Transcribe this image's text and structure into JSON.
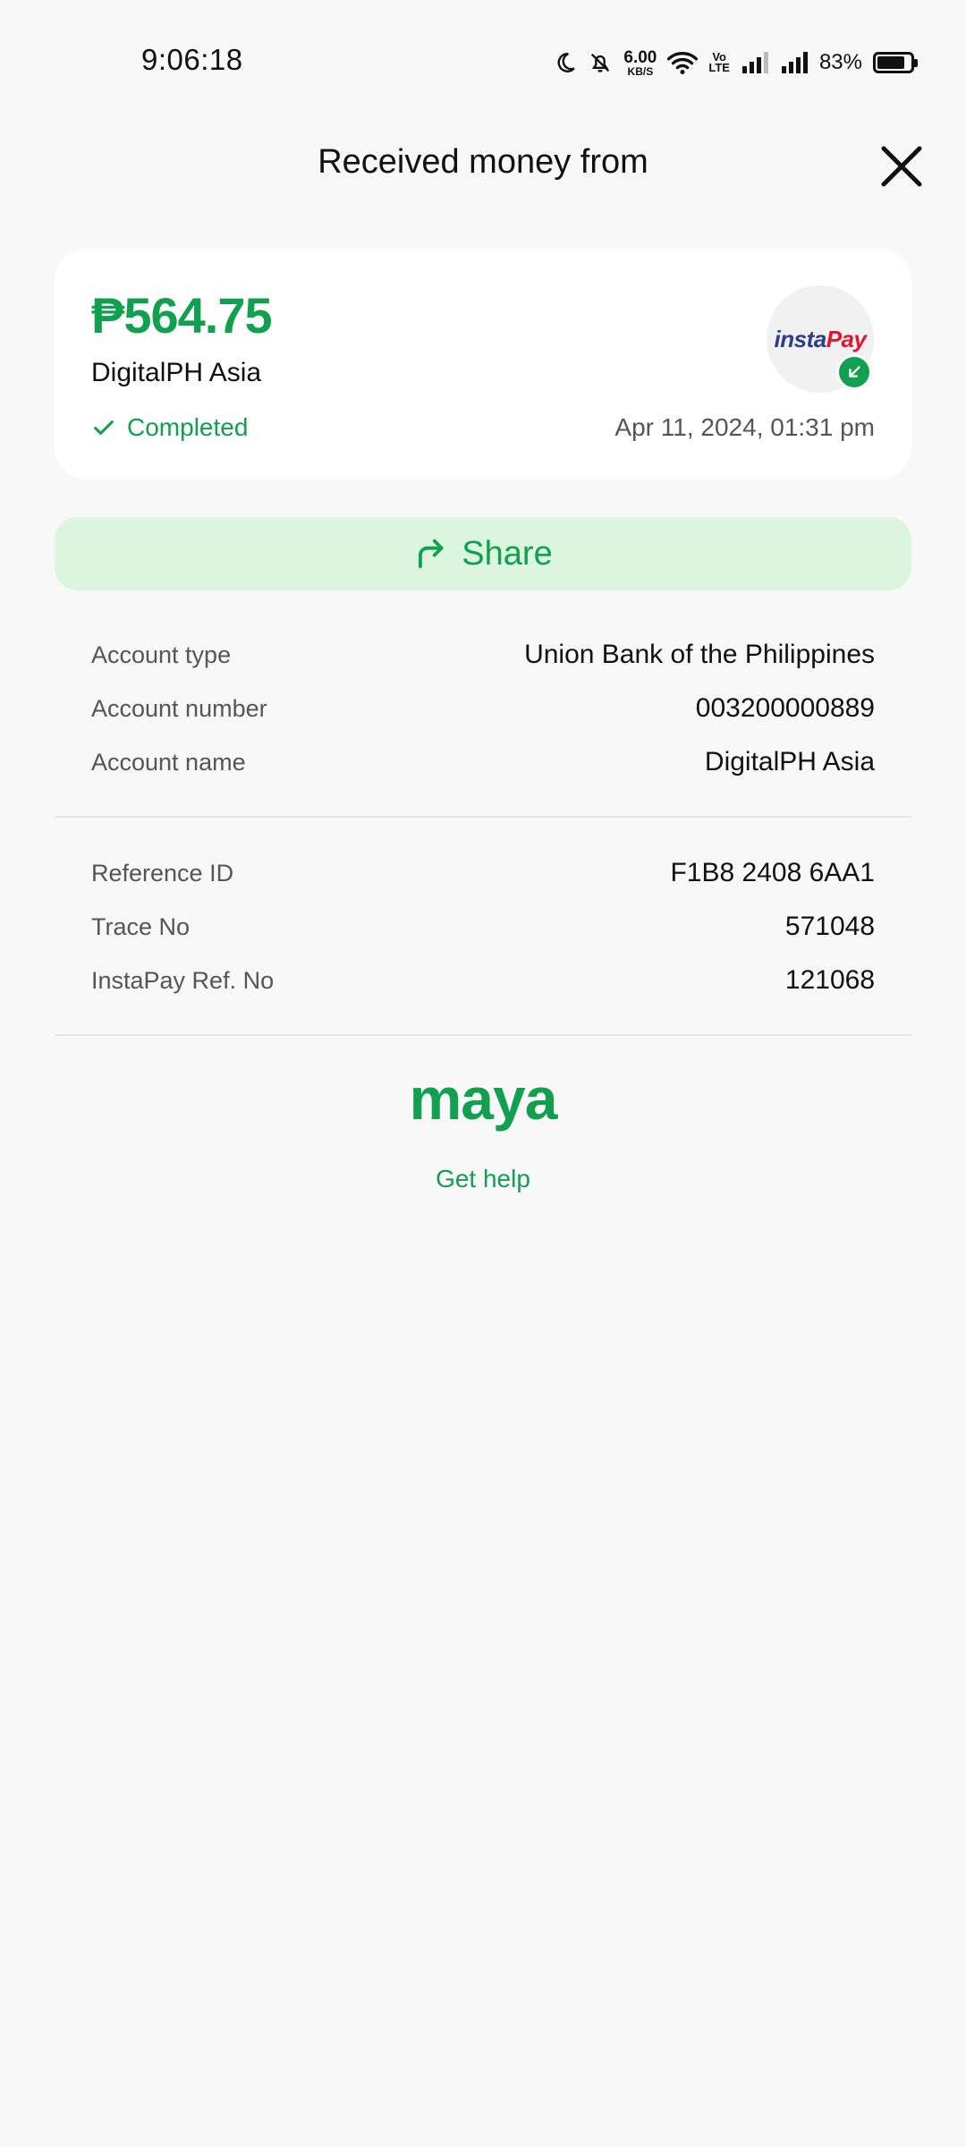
{
  "status_bar": {
    "time": "9:06:18",
    "net_speed_value": "6.00",
    "net_speed_unit": "KB/S",
    "volte_top": "Vo",
    "volte_bottom": "LTE",
    "battery_percent": "83%",
    "battery_level": 0.83
  },
  "header": {
    "title": "Received money from",
    "close_icon": "close-icon"
  },
  "summary": {
    "amount": "₱564.75",
    "payer_name": "DigitalPH Asia",
    "status": "Completed",
    "date": "Apr 11, 2024, 01:31 pm",
    "bank_logo_insta": "insta",
    "bank_logo_pay": "Pay",
    "badge_icon": "incoming-arrow-icon",
    "accent_color": "#10a050"
  },
  "share_button": {
    "label": "Share",
    "icon": "share-arrow-icon"
  },
  "account_details": [
    {
      "label": "Account type",
      "value": "Union Bank of the Philippines"
    },
    {
      "label": "Account number",
      "value": "003200000889"
    },
    {
      "label": "Account name",
      "value": "DigitalPH Asia"
    }
  ],
  "reference_details": [
    {
      "label": "Reference ID",
      "value": "F1B8 2408 6AA1"
    },
    {
      "label": "Trace No",
      "value": "571048"
    },
    {
      "label": "InstaPay Ref. No",
      "value": "121068"
    }
  ],
  "footer": {
    "brand": "maya",
    "help_link": "Get help"
  }
}
